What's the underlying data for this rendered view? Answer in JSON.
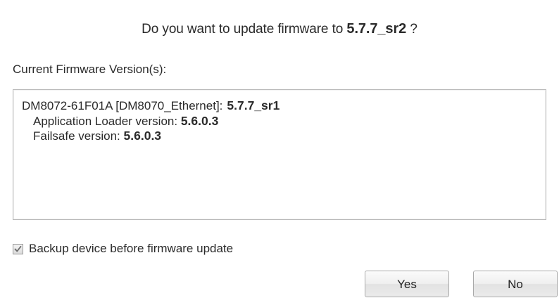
{
  "dialog": {
    "question_prefix": "Do you want to update firmware to",
    "target_version": "5.7.7_sr2",
    "question_suffix": "?"
  },
  "current_versions": {
    "label": "Current Firmware Version(s):",
    "device_line": "DM8072-61F01A [DM8070_Ethernet]:",
    "device_version": "5.7.7_sr1",
    "loader_label": "Application Loader version:",
    "loader_version": "5.6.0.3",
    "failsafe_label": "Failsafe version:",
    "failsafe_version": "5.6.0.3"
  },
  "backup": {
    "label": "Backup device before firmware update",
    "checked": true
  },
  "buttons": {
    "yes": "Yes",
    "no": "No"
  }
}
